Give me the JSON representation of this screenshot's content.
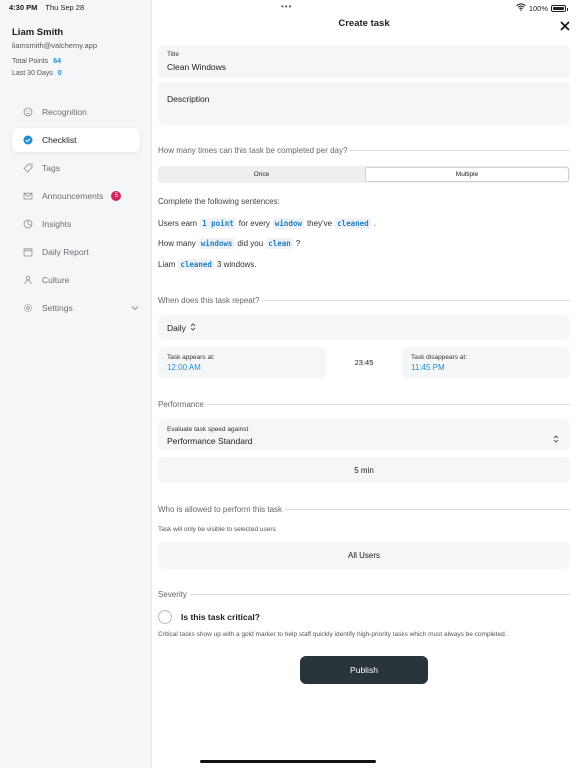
{
  "status": {
    "time": "4:30 PM",
    "date": "Thu Sep 28",
    "battery": "100%"
  },
  "user": {
    "name": "Liam Smith",
    "email": "liamsmith@valchemy.app"
  },
  "stats": [
    {
      "label": "Total Points",
      "value": "64"
    },
    {
      "label": "Last 30 Days",
      "value": "0"
    }
  ],
  "nav": [
    {
      "label": "Recognition",
      "icon": "smiley-icon"
    },
    {
      "label": "Checklist",
      "icon": "check-circle-icon",
      "active": true
    },
    {
      "label": "Tags",
      "icon": "tag-icon"
    },
    {
      "label": "Announcements",
      "icon": "envelope-icon",
      "badge": "5"
    },
    {
      "label": "Insights",
      "icon": "pie-chart-icon"
    },
    {
      "label": "Daily Report",
      "icon": "calendar-icon"
    },
    {
      "label": "Culture",
      "icon": "person-icon"
    },
    {
      "label": "Settings",
      "icon": "gear-icon"
    }
  ],
  "header": {
    "title": "Create task"
  },
  "form": {
    "title_label": "Title",
    "title_value": "Clean Windows",
    "description_label": "Description",
    "frequency_question": "How many times can this task be completed per day?",
    "frequency_options": [
      "Once",
      "Multiple"
    ],
    "frequency_selected": "Multiple",
    "sentences_heading": "Complete the following sentences:",
    "s1": {
      "a": "Users earn",
      "points": "1 point",
      "b": "for every",
      "noun": "window",
      "c": "they've",
      "verb": "cleaned",
      "d": "."
    },
    "s2": {
      "a": "How many",
      "noun": "windows",
      "b": "did you",
      "verb": "clean",
      "c": "?"
    },
    "s3": {
      "name": "Liam",
      "verb": "cleaned",
      "rest": "3 windows."
    },
    "repeat_heading": "When does this task repeat?",
    "repeat_value": "Daily",
    "appears_label": "Task appears at:",
    "appears_value": "12:00 AM",
    "duration": "23:45",
    "disappears_label": "Task disappears at:",
    "disappears_value": "11:45 PM",
    "performance_heading": "Performance",
    "evaluate_label": "Evaluate task speed against",
    "evaluate_value": "Performance Standard",
    "standard_value": "5 min",
    "allowed_heading": "Who is allowed to perform this task",
    "allowed_note": "Task will only be visible to selected users",
    "allowed_value": "All Users",
    "severity_heading": "Severity",
    "critical_label": "Is this task critical?",
    "critical_note": "Critical tasks show up with a gold marker to help staff quickly identify high-priority tasks which must always be completed.",
    "publish_label": "Publish"
  },
  "colors": {
    "accent": "#1f8fd6",
    "badge": "#d6245c",
    "publish": "#2a343b"
  }
}
